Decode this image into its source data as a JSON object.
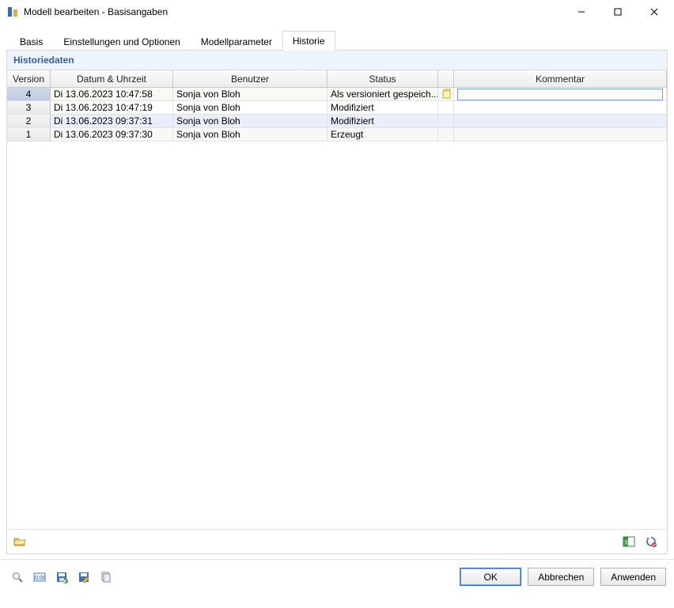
{
  "window": {
    "title": "Modell bearbeiten - Basisangaben"
  },
  "tabs": [
    {
      "label": "Basis"
    },
    {
      "label": "Einstellungen und Optionen"
    },
    {
      "label": "Modellparameter"
    },
    {
      "label": "Historie"
    }
  ],
  "section": {
    "title": "Historiedaten"
  },
  "grid": {
    "columns": {
      "version": "Version",
      "datum": "Datum & Uhrzeit",
      "benutzer": "Benutzer",
      "status": "Status",
      "kommentar": "Kommentar"
    },
    "rows": [
      {
        "version": "4",
        "datum": "Di 13.06.2023 10:47:58",
        "benutzer": "Sonja von Bloh",
        "status": "Als versioniert gespeich...",
        "has_note_icon": true,
        "kommentar": ""
      },
      {
        "version": "3",
        "datum": "Di 13.06.2023 10:47:19",
        "benutzer": "Sonja von Bloh",
        "status": "Modifiziert",
        "has_note_icon": false,
        "kommentar": ""
      },
      {
        "version": "2",
        "datum": "Di 13.06.2023 09:37:31",
        "benutzer": "Sonja von Bloh",
        "status": "Modifiziert",
        "has_note_icon": false,
        "kommentar": ""
      },
      {
        "version": "1",
        "datum": "Di 13.06.2023 09:37:30",
        "benutzer": "Sonja von Bloh",
        "status": "Erzeugt",
        "has_note_icon": false,
        "kommentar": ""
      }
    ]
  },
  "buttons": {
    "ok": "OK",
    "cancel": "Abbrechen",
    "apply": "Anwenden"
  }
}
